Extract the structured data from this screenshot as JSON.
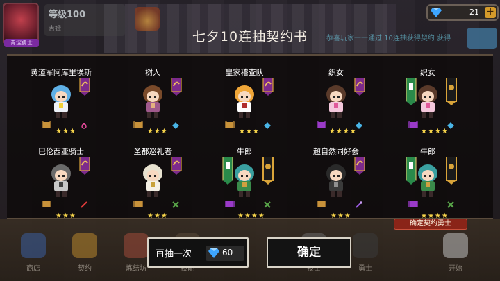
{
  "player": {
    "level": "等级100",
    "subtitle": "吉姆",
    "badge": "青涩勇士"
  },
  "currency": {
    "gems": "21",
    "plus": "+"
  },
  "marquee": "恭喜玩家一一通过 10连抽获得契约 获得",
  "dialog": {
    "title": "七夕10连抽契约书",
    "cards": [
      {
        "name": "黄道军阿库里埃斯",
        "stars": "★★★",
        "element": "magic-ring",
        "banner": "single"
      },
      {
        "name": "树人",
        "stars": "★★★",
        "element": "gem",
        "banner": "single"
      },
      {
        "name": "皇家稽查队",
        "stars": "★★★",
        "element": "gem",
        "banner": "single"
      },
      {
        "name": "织女",
        "stars": "★★★★",
        "element": "gem",
        "banner": "single"
      },
      {
        "name": "织女",
        "stars": "★★★★",
        "element": "gem",
        "banner": "double"
      },
      {
        "name": "巴伦西亚骑士",
        "stars": "★★★",
        "element": "sword",
        "banner": "single"
      },
      {
        "name": "圣都巡礼者",
        "stars": "★★★",
        "element": "cross-swords",
        "banner": "single"
      },
      {
        "name": "牛郎",
        "stars": "★★★★",
        "element": "cross-swords",
        "banner": "double"
      },
      {
        "name": "超自然同好会",
        "stars": "★★★",
        "element": "wand",
        "banner": "single"
      },
      {
        "name": "牛郎",
        "stars": "★★★★",
        "element": "cross-swords",
        "banner": "double"
      }
    ],
    "confirm_tag": "确定契约勇士",
    "redraw_label": "再抽一次",
    "redraw_cost": "60",
    "confirm_label": "确定"
  },
  "nav": [
    {
      "label": "商店",
      "color": "#3a5fa0"
    },
    {
      "label": "契约",
      "color": "#b8862e"
    },
    {
      "label": "炼结坊",
      "color": "#a04a3a"
    },
    {
      "label": "技能",
      "color": "#5a4a3a"
    },
    {
      "label": "技士",
      "color": "#6a6a6a"
    },
    {
      "label": "勇士",
      "color": "#3a3a3a"
    },
    {
      "label": "开始",
      "color": "#bfbfbf"
    }
  ],
  "colors": {
    "banner_purple": "#7d2a8c",
    "banner_gold": "#d9a43a",
    "star": "#f4d24a"
  }
}
